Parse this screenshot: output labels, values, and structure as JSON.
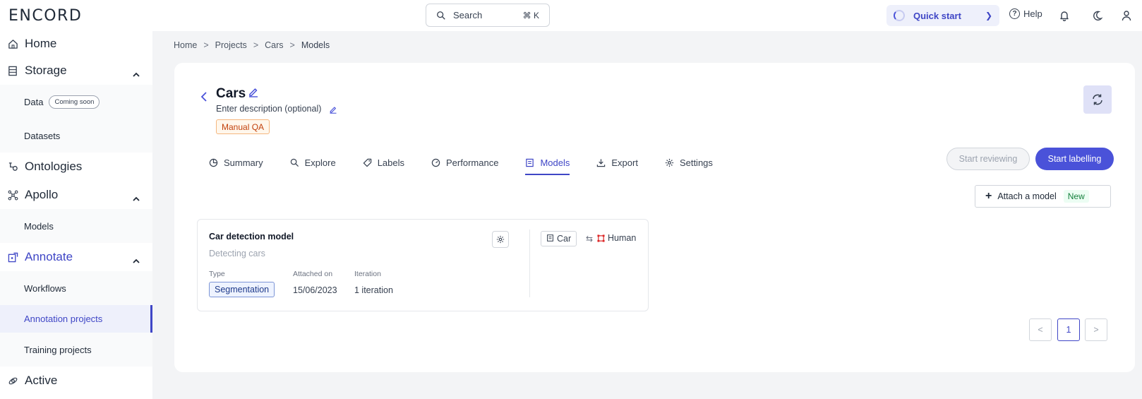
{
  "app": {
    "logo": "ENCORD"
  },
  "topbar": {
    "search_label": "Search",
    "search_shortcut": "⌘ K",
    "quick_start": "Quick start",
    "help": "Help",
    "icons": [
      "bell-icon",
      "moon-icon",
      "user-icon"
    ]
  },
  "sidebar": {
    "home": "Home",
    "storage": "Storage",
    "data": "Data",
    "coming_soon": "Coming soon",
    "datasets": "Datasets",
    "ontologies": "Ontologies",
    "apollo": "Apollo",
    "models": "Models",
    "annotate": "Annotate",
    "workflows": "Workflows",
    "annotation_projects": "Annotation projects",
    "training_projects": "Training projects",
    "active": "Active"
  },
  "breadcrumb": [
    "Home",
    "Projects",
    "Cars",
    "Models"
  ],
  "breadcrumb_sep": ">",
  "project": {
    "title": "Cars",
    "description_placeholder": "Enter description (optional)",
    "tag": "Manual QA"
  },
  "tabs": [
    {
      "label": "Summary",
      "icon": "pie-chart-icon"
    },
    {
      "label": "Explore",
      "icon": "search-icon"
    },
    {
      "label": "Labels",
      "icon": "tag-icon"
    },
    {
      "label": "Performance",
      "icon": "gauge-icon"
    },
    {
      "label": "Models",
      "icon": "model-icon",
      "active": true
    },
    {
      "label": "Export",
      "icon": "download-icon"
    },
    {
      "label": "Settings",
      "icon": "gear-icon"
    }
  ],
  "actions": {
    "start_reviewing": "Start reviewing",
    "start_labelling": "Start labelling",
    "attach_model": "Attach a model",
    "new_badge": "New"
  },
  "model_card": {
    "title": "Car detection model",
    "description": "Detecting cars",
    "type_label": "Type",
    "type_value": "Segmentation",
    "attached_label": "Attached on",
    "attached_value": "15/06/2023",
    "iteration_label": "Iteration",
    "iteration_value": "1 iteration",
    "mapping_from": "Car",
    "mapping_to": "Human"
  },
  "pagination": {
    "current_page": "1",
    "prev": "<",
    "next": ">"
  },
  "colors": {
    "accent": "#4a52d9",
    "accent_light": "#eef0fb",
    "tag_orange": "#c2410c",
    "new_green": "#15803d"
  }
}
